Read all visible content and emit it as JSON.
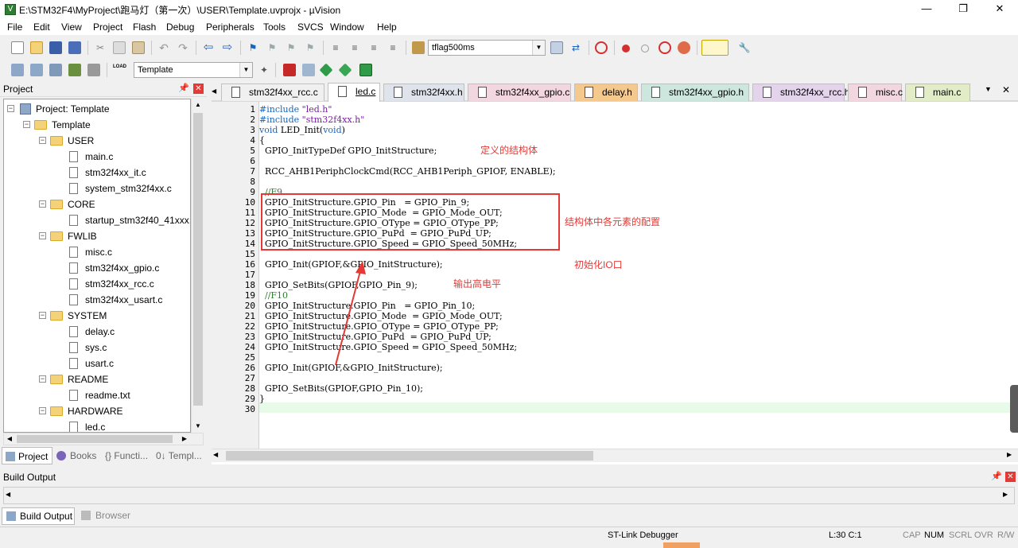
{
  "window": {
    "title": "E:\\STM32F4\\MyProject\\跑马灯（第一次）\\USER\\Template.uvprojx - µVision",
    "minimize": "—",
    "maximize": "❐",
    "close": "✕"
  },
  "menu": [
    "File",
    "Edit",
    "View",
    "Project",
    "Flash",
    "Debug",
    "Peripherals",
    "Tools",
    "SVCS",
    "Window",
    "Help"
  ],
  "toolbar": {
    "find_combo": "tflag500ms",
    "target_combo": "Template"
  },
  "project": {
    "header": "Project",
    "root": "Project: Template",
    "target": "Template",
    "groups": [
      {
        "name": "USER",
        "files": [
          "main.c",
          "stm32f4xx_it.c",
          "system_stm32f4xx.c"
        ]
      },
      {
        "name": "CORE",
        "files": [
          "startup_stm32f40_41xxx.s"
        ]
      },
      {
        "name": "FWLIB",
        "files": [
          "misc.c",
          "stm32f4xx_gpio.c",
          "stm32f4xx_rcc.c",
          "stm32f4xx_usart.c"
        ]
      },
      {
        "name": "SYSTEM",
        "files": [
          "delay.c",
          "sys.c",
          "usart.c"
        ]
      },
      {
        "name": "README",
        "files": [
          "readme.txt"
        ]
      },
      {
        "name": "HARDWARE",
        "files": [
          "led.c"
        ]
      }
    ],
    "tabs": [
      "Project",
      "Books",
      "{} Functi...",
      "0↓ Templ..."
    ]
  },
  "tabs": [
    {
      "label": "stm32f4xx_rcc.c",
      "bg": "#f0f0f0"
    },
    {
      "label": "led.c",
      "bg": "#ffffff",
      "active": true
    },
    {
      "label": "stm32f4xx.h",
      "bg": "#dfe3ec"
    },
    {
      "label": "stm32f4xx_gpio.c",
      "bg": "#f2d6e0"
    },
    {
      "label": "delay.h",
      "bg": "#f5c98e"
    },
    {
      "label": "stm32f4xx_gpio.h",
      "bg": "#cde6de"
    },
    {
      "label": "stm32f4xx_rcc.h",
      "bg": "#e3d4ec"
    },
    {
      "label": "misc.c",
      "bg": "#f2d6e0"
    },
    {
      "label": "main.c",
      "bg": "#e2ecc7"
    }
  ],
  "code": [
    "#include \"led.h\"",
    "#include \"stm32f4xx.h\"",
    "void LED_Init(void)",
    "{",
    "  GPIO_InitTypeDef GPIO_InitStructure;",
    "",
    "  RCC_AHB1PeriphClockCmd(RCC_AHB1Periph_GPIOF, ENABLE);",
    "",
    "  //F9",
    "  GPIO_InitStructure.GPIO_Pin   = GPIO_Pin_9;",
    "  GPIO_InitStructure.GPIO_Mode  = GPIO_Mode_OUT;",
    "  GPIO_InitStructure.GPIO_OType = GPIO_OType_PP;",
    "  GPIO_InitStructure.GPIO_PuPd  = GPIO_PuPd_UP;",
    "  GPIO_InitStructure.GPIO_Speed = GPIO_Speed_50MHz;",
    "",
    "  GPIO_Init(GPIOF,&GPIO_InitStructure);",
    "",
    "  GPIO_SetBits(GPIOF,GPIO_Pin_9);",
    "  //F10",
    "  GPIO_InitStructure.GPIO_Pin   = GPIO_Pin_10;",
    "  GPIO_InitStructure.GPIO_Mode  = GPIO_Mode_OUT;",
    "  GPIO_InitStructure.GPIO_OType = GPIO_OType_PP;",
    "  GPIO_InitStructure.GPIO_PuPd  = GPIO_PuPd_UP;",
    "  GPIO_InitStructure.GPIO_Speed = GPIO_Speed_50MHz;",
    "",
    "  GPIO_Init(GPIOF,&GPIO_InitStructure);",
    "",
    "  GPIO_SetBits(GPIOF,GPIO_Pin_10);",
    "}",
    ""
  ],
  "annotations": {
    "a1": "定义的结构体",
    "a2": "结构体中各元素的配置",
    "a3": "初始化IO口",
    "a4": "输出高电平"
  },
  "build": {
    "header": "Build Output",
    "tabs": [
      "Build Output",
      "Browser"
    ]
  },
  "status": {
    "debugger": "ST-Link Debugger",
    "pos": "L:30 C:1",
    "caps": "CAP",
    "num": "NUM",
    "scrl": "SCRL",
    "ovr": "OVR",
    "rw": "R/W"
  }
}
